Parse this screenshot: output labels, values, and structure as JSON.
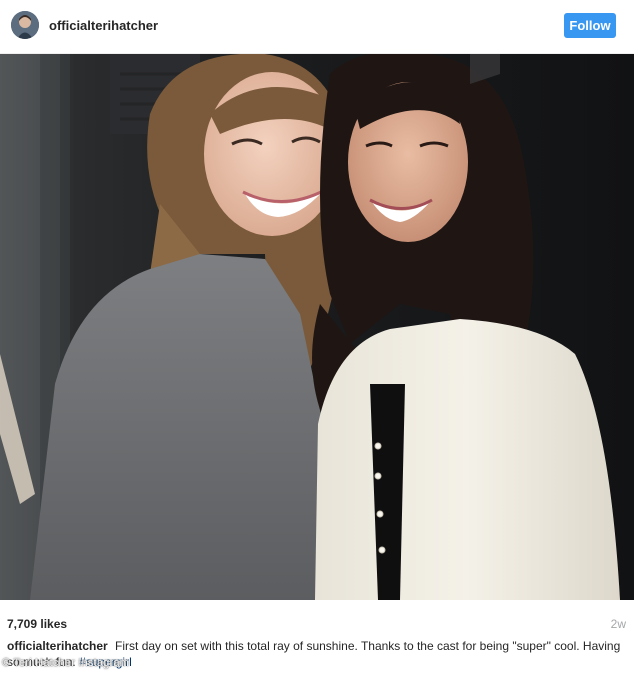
{
  "header": {
    "username": "officialterihatcher",
    "follow_label": "Follow"
  },
  "post": {
    "likes": "7,709 likes",
    "timestamp": "2w",
    "caption": {
      "username": "officialterihatcher",
      "text": "First day on set with this total ray of sunshine. Thanks to the cast for being \"super\" cool. Having so much fun.",
      "hashtag": "#supergirl"
    }
  },
  "watermark": "© Teri Hatcher Instagram",
  "colors": {
    "follow_button": "#3897f0",
    "hashtag": "#003569",
    "timestamp": "#a5a7aa",
    "text": "#262626"
  },
  "icons": {
    "avatar": "profile-avatar"
  }
}
